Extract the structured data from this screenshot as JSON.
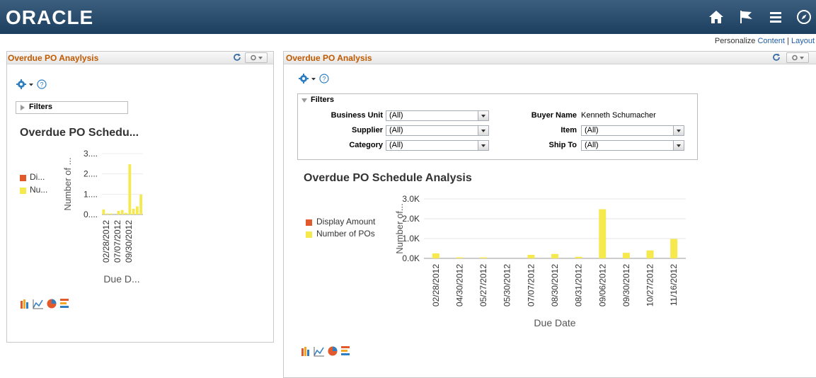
{
  "header": {
    "logo_text": "ORACLE",
    "icons": [
      "home-icon",
      "flag-icon",
      "menu-icon",
      "navigator-icon"
    ]
  },
  "personalize": {
    "prefix": "Personalize",
    "content": "Content",
    "sep": " | ",
    "layout": "Layout"
  },
  "left_pagelet": {
    "title": "Overdue PO Anaylysis",
    "filters_label": "Filters",
    "chart_title": "Overdue PO Schedu...",
    "legend": [
      "Di...",
      "Nu..."
    ],
    "y_axis_label": "Number of ...",
    "y_ticks": [
      "3....",
      "2....",
      "1....",
      "0...."
    ],
    "x_ticks": [
      "02/28/2012",
      "07/07/2012",
      "09/30/2012"
    ],
    "x_axis_label": "Due D..."
  },
  "right_pagelet": {
    "title": "Overdue PO Analysis",
    "filters_label": "Filters",
    "filters": {
      "business_unit": {
        "label": "Business Unit",
        "value": "(All)"
      },
      "supplier": {
        "label": "Supplier",
        "value": "(All)"
      },
      "category": {
        "label": "Category",
        "value": "(All)"
      },
      "buyer_name": {
        "label": "Buyer Name",
        "value": "Kenneth Schumacher"
      },
      "item": {
        "label": "Item",
        "value": "(All)"
      },
      "ship_to": {
        "label": "Ship To",
        "value": "(All)"
      }
    }
  },
  "chart_data": [
    {
      "type": "bar",
      "title": "Overdue PO Schedule Analysis",
      "xlabel": "Due Date",
      "ylabel": "Number of...",
      "ylim": [
        0,
        3000
      ],
      "y_ticks": [
        "0.0K",
        "1.0K",
        "2.0K",
        "3.0K"
      ],
      "categories": [
        "02/28/2012",
        "04/30/2012",
        "05/27/2012",
        "05/30/2012",
        "07/07/2012",
        "08/30/2012",
        "08/31/2012",
        "09/06/2012",
        "09/30/2012",
        "10/27/2012",
        "11/16/2012"
      ],
      "series": [
        {
          "name": "Display Amount",
          "color": "#e25a2b",
          "values": [
            0,
            0,
            0,
            0,
            0,
            0,
            0,
            0,
            0,
            0,
            0
          ]
        },
        {
          "name": "Number of POs",
          "color": "#f5e94d",
          "values": [
            250,
            50,
            50,
            0,
            180,
            220,
            80,
            2480,
            280,
            400,
            980
          ]
        }
      ],
      "grid": true,
      "legend": "left"
    },
    {
      "type": "bar",
      "title": "Overdue PO Schedu...",
      "xlabel": "Due D...",
      "ylabel": "Number of ...",
      "y_ticks": [
        "0....",
        "1....",
        "2....",
        "3...."
      ],
      "ylim": [
        0,
        3000
      ],
      "series": [
        {
          "name": "Number of POs",
          "color": "#f5e94d",
          "values": [
            250,
            50,
            50,
            0,
            180,
            220,
            80,
            2480,
            280,
            400,
            980
          ]
        }
      ]
    }
  ]
}
